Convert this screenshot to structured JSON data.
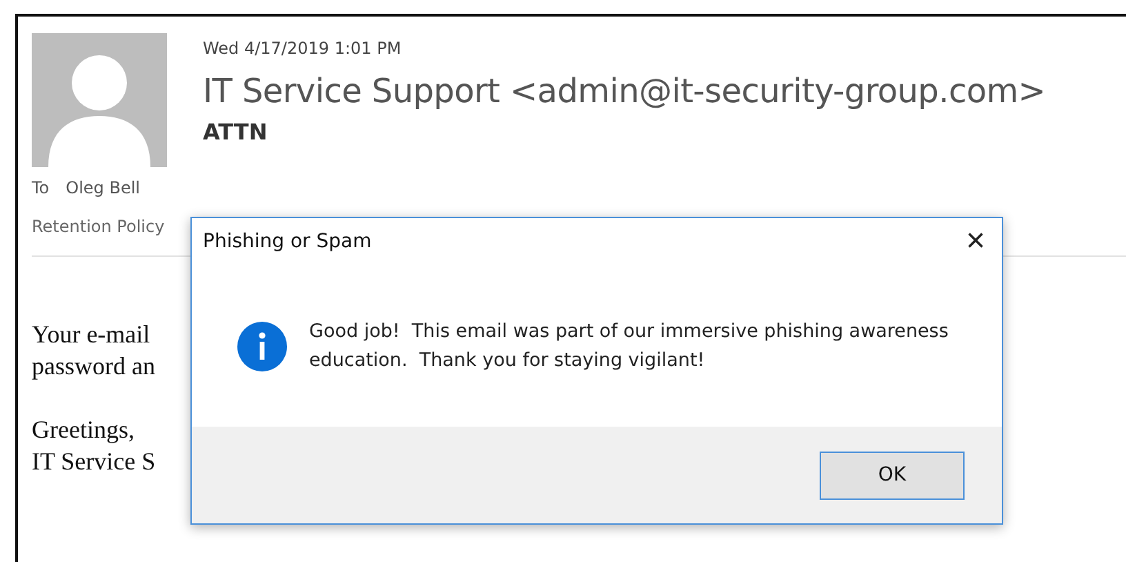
{
  "email": {
    "date": "Wed 4/17/2019 1:01 PM",
    "sender": "IT Service Support <admin@it-security-group.com>",
    "subject": "ATTN",
    "to_label": "To",
    "to": "Oleg Bell",
    "retention": "Retention Policy",
    "body_paragraphs": [
      [
        "Your e-mail",
        "password an"
      ],
      [
        "Greetings,",
        "IT Service S"
      ]
    ]
  },
  "dialog": {
    "title": "Phishing or Spam",
    "close": "×",
    "message_lines": [
      "Good job!  This email was part of our immersive phishing awareness",
      "education.  Thank you for staying vigilant!"
    ],
    "buttons": [
      {
        "label": "OK",
        "kind": "default"
      }
    ]
  }
}
